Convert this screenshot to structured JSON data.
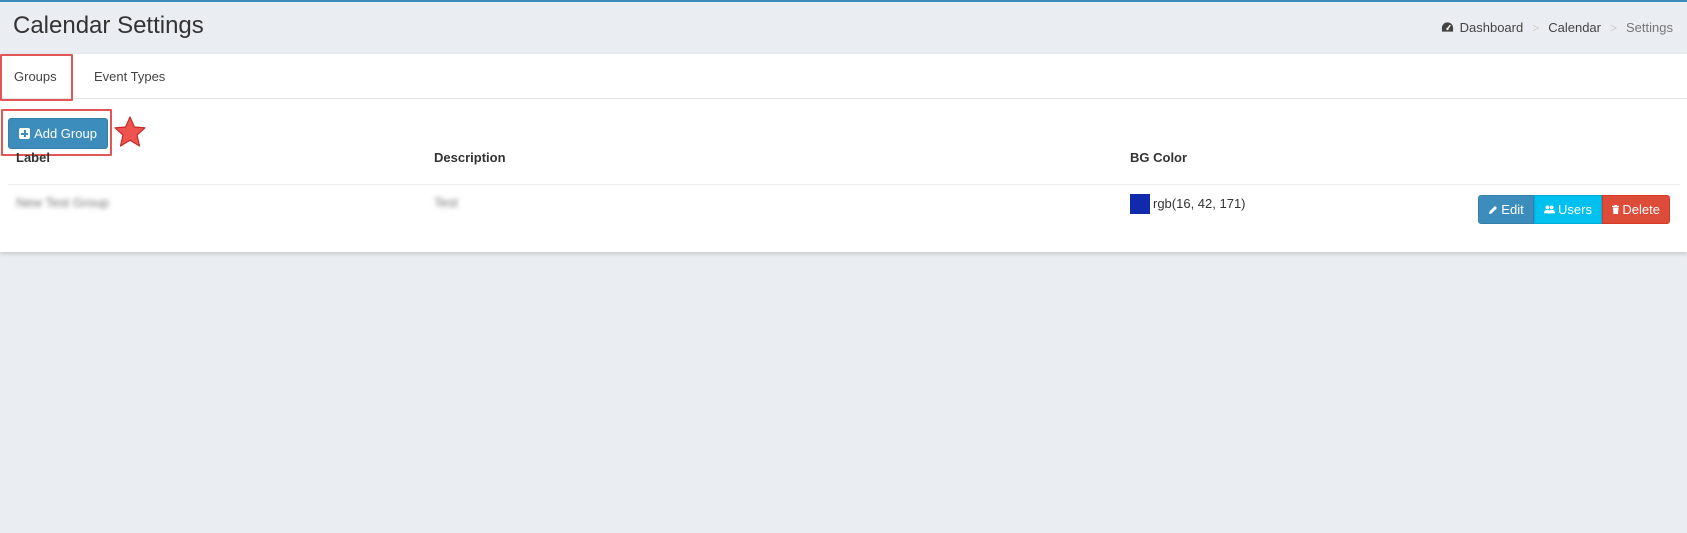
{
  "header": {
    "title": "Calendar Settings",
    "breadcrumb": {
      "dashboard": "Dashboard",
      "calendar": "Calendar",
      "current": "Settings",
      "separator": ">"
    }
  },
  "tabs": {
    "groups": "Groups",
    "event_types": "Event Types"
  },
  "toolbar": {
    "add_group_label": "Add Group"
  },
  "table": {
    "columns": {
      "label": "Label",
      "description": "Description",
      "bg_color": "BG Color"
    },
    "rows": [
      {
        "label": "New Test Group",
        "description": "Test",
        "bg_color_text": "rgb(16, 42, 171)",
        "swatch_color": "#102aab"
      }
    ],
    "actions": {
      "edit": "Edit",
      "users": "Users",
      "delete": "Delete"
    }
  },
  "colors": {
    "accent": "#3c8dbc",
    "info": "#00c0ef",
    "danger": "#dd4b39",
    "highlight": "#e25656"
  },
  "icons": [
    "dashboard-icon",
    "plus-square-icon",
    "star-icon",
    "pencil-icon",
    "users-icon",
    "trash-icon"
  ]
}
